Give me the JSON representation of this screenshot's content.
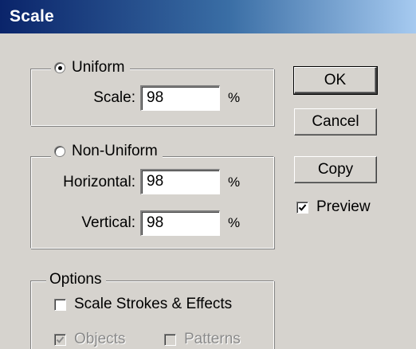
{
  "window": {
    "title": "Scale"
  },
  "uniform": {
    "label": "Uniform",
    "selected": true,
    "scale_label": "Scale:",
    "scale_value": "98",
    "scale_unit": "%"
  },
  "non_uniform": {
    "label": "Non-Uniform",
    "selected": false,
    "horizontal_label": "Horizontal:",
    "horizontal_value": "98",
    "horizontal_unit": "%",
    "vertical_label": "Vertical:",
    "vertical_value": "98",
    "vertical_unit": "%"
  },
  "options": {
    "label": "Options",
    "scale_strokes_label": "Scale Strokes & Effects",
    "scale_strokes_checked": false,
    "objects_label": "Objects",
    "objects_checked": true,
    "objects_enabled": false,
    "patterns_label": "Patterns",
    "patterns_checked": false,
    "patterns_enabled": false
  },
  "buttons": {
    "ok": "OK",
    "cancel": "Cancel",
    "copy": "Copy"
  },
  "preview": {
    "label": "Preview",
    "checked": true
  }
}
